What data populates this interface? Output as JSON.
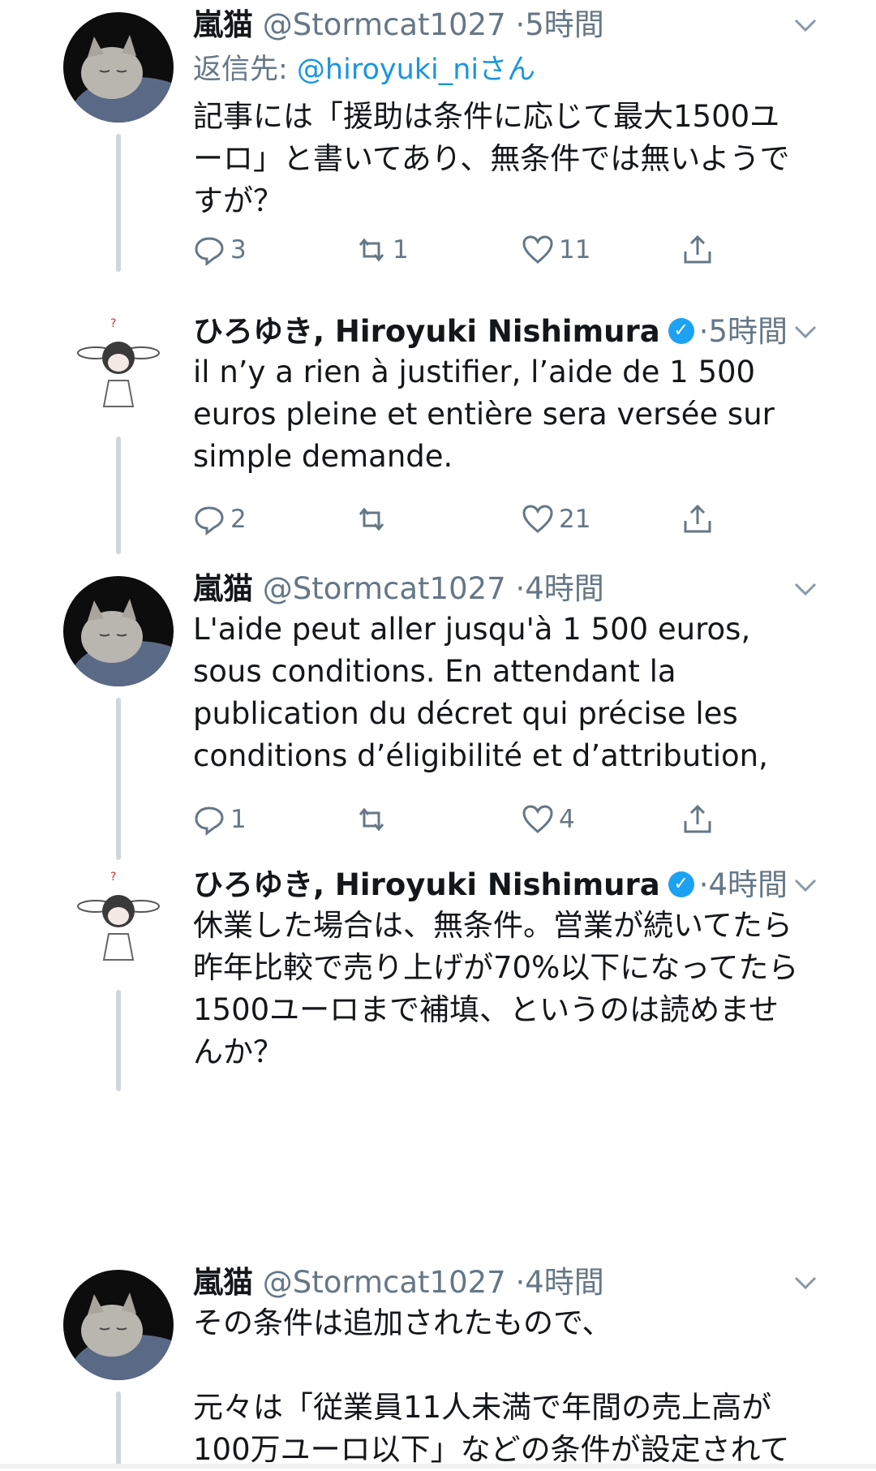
{
  "tweets": [
    {
      "name": "嵐猫",
      "handle": "@Stormcat1027",
      "dot": "·",
      "time": "5時間",
      "reply_prefix": "返信先: ",
      "reply_to": "@hiroyuki_niさん",
      "text": "記事には「援助は条件に応じて最大1500ユ\nーロ」と書いてあり、無条件では無いようで\nすが？",
      "replies": "3",
      "retweets": "1",
      "likes": "11"
    },
    {
      "name": "ひろゆき, Hiroyuki Nishimura",
      "verified": "✓",
      "dot": "·",
      "time": "5時間",
      "text": "il n’y a rien à justifier, l’aide de 1 500\neuros pleine et entière sera versée sur\nsimple demande.",
      "replies": "2",
      "retweets": "",
      "likes": "21"
    },
    {
      "name": "嵐猫",
      "handle": "@Stormcat1027",
      "dot": "·",
      "time": "4時間",
      "text": "L'aide peut aller jusqu'à 1 500 euros,\nsous conditions. En attendant la\npublication du décret qui précise les\nconditions d’éligibilité et d’attribution,",
      "replies": "1",
      "retweets": "",
      "likes": "4"
    },
    {
      "name": "ひろゆき, Hiroyuki Nishimura",
      "verified": "✓",
      "dot": "·",
      "time": "4時間",
      "text": "休業した場合は、無条件。営業が続いてたら\n昨年比較で売り上げが70%以下になってたら\n1500ユーロまで補填、というのは読めませ\nんか？"
    },
    {
      "name": "嵐猫",
      "handle": "@Stormcat1027",
      "dot": "·",
      "time": "4時間",
      "text": "その条件は追加されたもので、\n\n元々は「従業員11人未満で年間の売上高が\n100万ユーロ以下」などの条件が設定されて"
    }
  ],
  "colors": {
    "text": "#14171a",
    "muted": "#657786",
    "link": "#1b95e0",
    "verified": "#1da1f2",
    "thread": "#cfd6dc"
  },
  "icons": [
    "chevron-down-icon",
    "reply-icon",
    "retweet-icon",
    "heart-icon",
    "share-icon",
    "verified-badge-icon"
  ]
}
